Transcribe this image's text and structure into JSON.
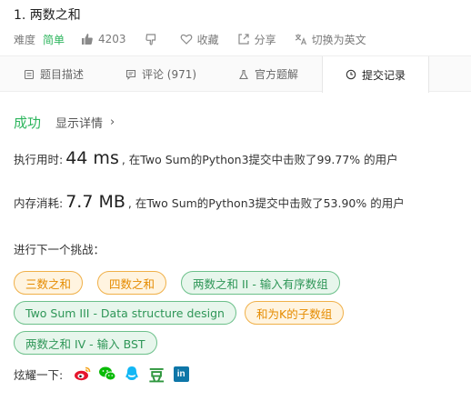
{
  "problem": {
    "title": "1. 两数之和",
    "difficulty_label": "难度",
    "difficulty_value": "简单",
    "likes": "4203",
    "favorite_label": "收藏",
    "share_label": "分享",
    "switch_lang_label": "切换为英文"
  },
  "tabs": [
    {
      "label": "题目描述",
      "icon": "document-icon"
    },
    {
      "label": "评论 (971)",
      "icon": "comment-icon"
    },
    {
      "label": "官方题解",
      "icon": "flask-icon"
    },
    {
      "label": "提交记录",
      "icon": "clock-icon"
    }
  ],
  "result": {
    "status": "成功",
    "detail_link": "显示详情",
    "chevron": "›",
    "runtime_prefix": "执行用时:",
    "runtime_value": "44 ms",
    "runtime_suffix": ", 在Two Sum的Python3提交中击败了99.77% 的用户",
    "memory_prefix": "内存消耗:",
    "memory_value": "7.7 MB",
    "memory_suffix": ", 在Two Sum的Python3提交中击败了53.90% 的用户"
  },
  "next": {
    "label": "进行下一个挑战：",
    "tags": [
      {
        "text": "三数之和",
        "difficulty": "medium"
      },
      {
        "text": "四数之和",
        "difficulty": "medium"
      },
      {
        "text": "两数之和 II - 输入有序数组",
        "difficulty": "easy"
      },
      {
        "text": "Two Sum III - Data structure design",
        "difficulty": "easy"
      },
      {
        "text": "和为K的子数组",
        "difficulty": "medium"
      },
      {
        "text": "两数之和 IV - 输入 BST",
        "difficulty": "easy"
      }
    ]
  },
  "share_bar": {
    "label": "炫耀一下:",
    "icons": [
      "weibo-icon",
      "wechat-icon",
      "qq-icon",
      "douban-icon",
      "linkedin-icon"
    ],
    "douban_glyph": "豆",
    "linkedin_glyph": "in"
  },
  "colors": {
    "accent_green": "#2db55d",
    "tag_orange": "#e58b00",
    "tag_green": "#2e9657"
  }
}
